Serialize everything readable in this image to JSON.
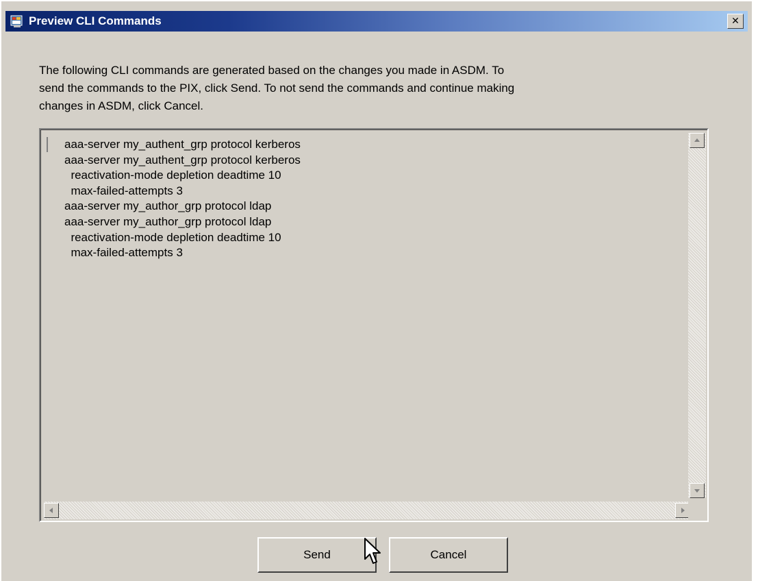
{
  "window": {
    "title": "Preview CLI Commands",
    "close_glyph": "✕",
    "icon": "asdm-app-icon"
  },
  "description": {
    "lines": [
      "The following CLI commands are generated based on the changes you made in ASDM.  To",
      "send the commands to the PIX, click Send.  To not send the commands and continue making",
      "changes in ASDM, click Cancel."
    ]
  },
  "commands": [
    "aaa-server my_authent_grp protocol kerberos",
    "aaa-server my_authent_grp protocol kerberos",
    "  reactivation-mode depletion deadtime 10",
    "  max-failed-attempts 3",
    "aaa-server my_author_grp protocol ldap",
    "aaa-server my_author_grp protocol ldap",
    "  reactivation-mode depletion deadtime 10",
    "  max-failed-attempts 3"
  ],
  "buttons": {
    "send_label": "Send",
    "cancel_label": "Cancel"
  },
  "colors": {
    "title_start": "#0a246a",
    "title_end": "#a6caf0",
    "face": "#d4d0c8"
  }
}
